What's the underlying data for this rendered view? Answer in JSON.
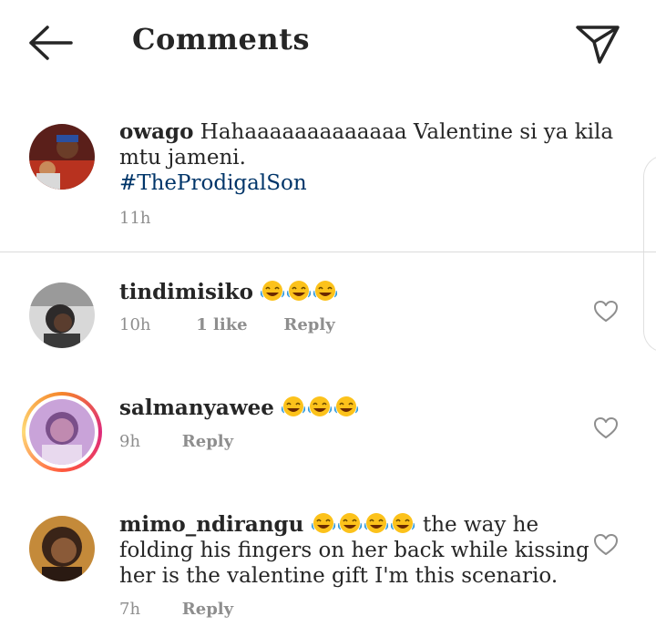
{
  "header": {
    "title": "Comments",
    "back_icon": "arrow-left-icon",
    "send_icon": "paper-plane-icon"
  },
  "caption": {
    "username": "owago",
    "text": "Hahaaaaaaaaaaaaa Valentine si ya kila mtu jameni.",
    "hashtag": "#TheProdigalSon",
    "time": "11h"
  },
  "comments": [
    {
      "username": "tindimisiko",
      "text": "",
      "emoji_count": 3,
      "time": "10h",
      "likes": "1 like",
      "reply": "Reply"
    },
    {
      "username": "salmanyawee",
      "text": "",
      "emoji_count": 3,
      "time": "9h",
      "reply": "Reply",
      "has_story_ring": true
    },
    {
      "username": "mimo_ndirangu",
      "text": "the way he folding his fingers on her back while kissing her is the valentine gift I'm this scenario.",
      "emoji_count": 4,
      "time": "7h",
      "reply": "Reply"
    }
  ],
  "colors": {
    "text": "#262626",
    "meta": "#8e8e8e",
    "hashtag": "#003569",
    "divider": "#dbdbdb"
  },
  "emoji": "face-with-tears-of-joy-icon"
}
